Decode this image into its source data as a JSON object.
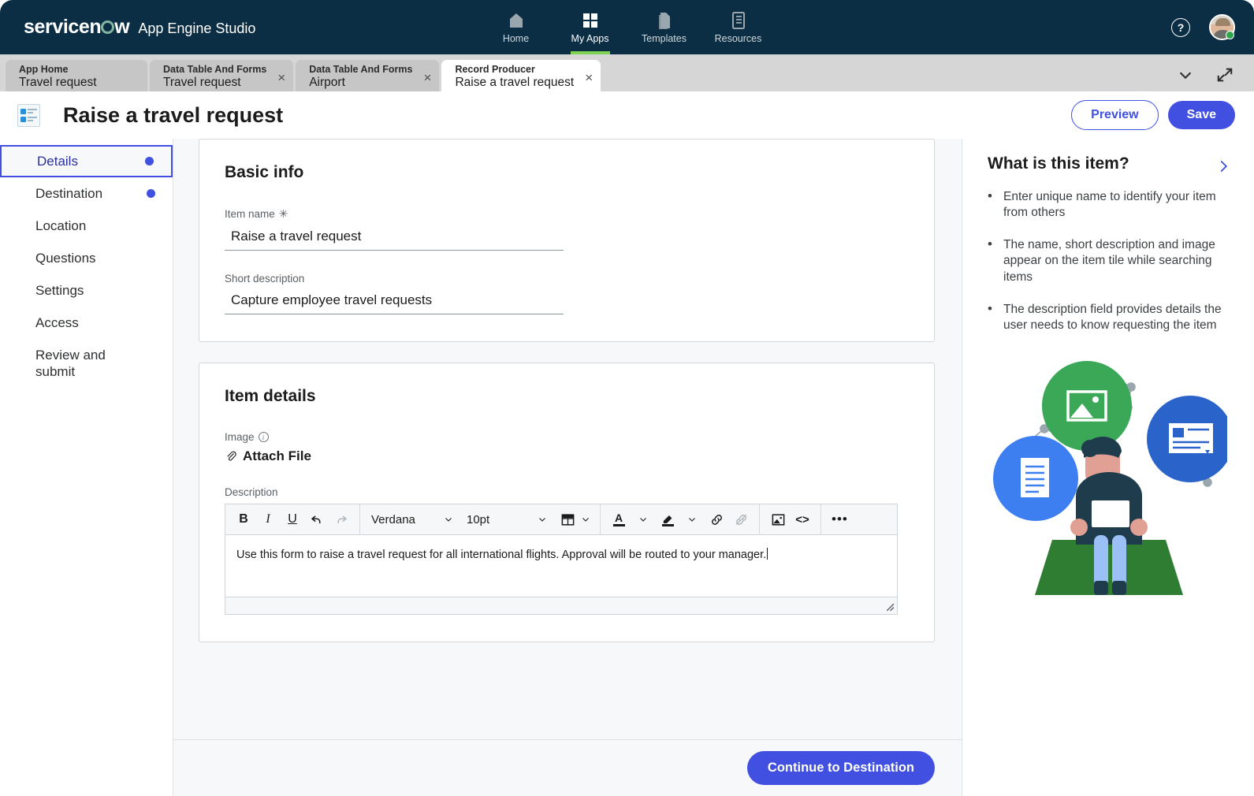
{
  "topnav": {
    "brand_name": "servicenow",
    "brand_app": "App Engine Studio",
    "items": [
      {
        "label": "Home",
        "icon": "home-icon",
        "active": false
      },
      {
        "label": "My Apps",
        "icon": "grid-icon",
        "active": true
      },
      {
        "label": "Templates",
        "icon": "templates-icon",
        "active": false
      },
      {
        "label": "Resources",
        "icon": "resources-icon",
        "active": false
      }
    ],
    "help_label": "?",
    "accent_green": "#7fd353",
    "background": "#0b2e44"
  },
  "tabstrip": {
    "tabs": [
      {
        "sub": "App Home",
        "main": "Travel request",
        "closable": false,
        "active": false
      },
      {
        "sub": "Data Table And Forms",
        "main": "Travel request",
        "closable": true,
        "active": false
      },
      {
        "sub": "Data Table And Forms",
        "main": "Airport",
        "closable": true,
        "active": false
      },
      {
        "sub": "Record Producer",
        "main": "Raise a travel request",
        "closable": true,
        "active": true
      }
    ],
    "close_glyph": "×",
    "collapse_icon": "chevron-down-icon",
    "expand_icon": "expand-arrows-icon"
  },
  "pagehead": {
    "icon": "record-producer-icon",
    "title": "Raise a travel request",
    "preview_label": "Preview",
    "save_label": "Save",
    "primary_color": "#4150e0"
  },
  "sidebar": {
    "items": [
      {
        "label": "Details",
        "active": true,
        "dot": true
      },
      {
        "label": "Destination",
        "active": false,
        "dot": true
      },
      {
        "label": "Location",
        "active": false,
        "dot": false
      },
      {
        "label": "Questions",
        "active": false,
        "dot": false
      },
      {
        "label": "Settings",
        "active": false,
        "dot": false
      },
      {
        "label": "Review and submit",
        "active": false,
        "dot": false
      }
    ],
    "access_label": "Access"
  },
  "basic_info": {
    "title": "Basic info",
    "item_name_label": "Item name",
    "item_name_required_glyph": "✳",
    "item_name_value": "Raise a travel request",
    "short_description_label": "Short description",
    "short_description_value": "Capture employee travel requests"
  },
  "item_details": {
    "title": "Item details",
    "image_label": "Image",
    "image_info_glyph": "i",
    "attach_label": "Attach File",
    "description_label": "Description",
    "editor": {
      "font_family_value": "Verdana",
      "font_size_value": "10pt",
      "buttons": [
        {
          "name": "bold-icon",
          "glyph": "B",
          "dim": false
        },
        {
          "name": "italic-icon",
          "glyph": "I",
          "dim": false
        },
        {
          "name": "underline-icon",
          "glyph": "U",
          "dim": false
        },
        {
          "name": "undo-icon",
          "glyph": "↶",
          "dim": false
        },
        {
          "name": "redo-icon",
          "glyph": "↷",
          "dim": true
        }
      ],
      "table_label": "table-icon",
      "text_color_label": "A",
      "highlight_label": "highlight-icon",
      "link_label": "link-icon",
      "unlink_label": "unlink-icon",
      "image_btn_label": "image-icon",
      "code_label": "<>",
      "more_label": "•••",
      "body_text": "Use this form to raise a travel request for all international flights. Approval will be routed to your manager."
    }
  },
  "footer": {
    "continue_label": "Continue to Destination"
  },
  "rightpanel": {
    "title": "What is this item?",
    "expand_icon": "chevron-right-icon",
    "bullets": [
      "Enter unique name to identify your item from others",
      "The name, short description and image appear on the item tile while searching items",
      "The description field provides details the user needs to know requesting the item"
    ],
    "illustration": "person-with-laptop-illustration"
  }
}
